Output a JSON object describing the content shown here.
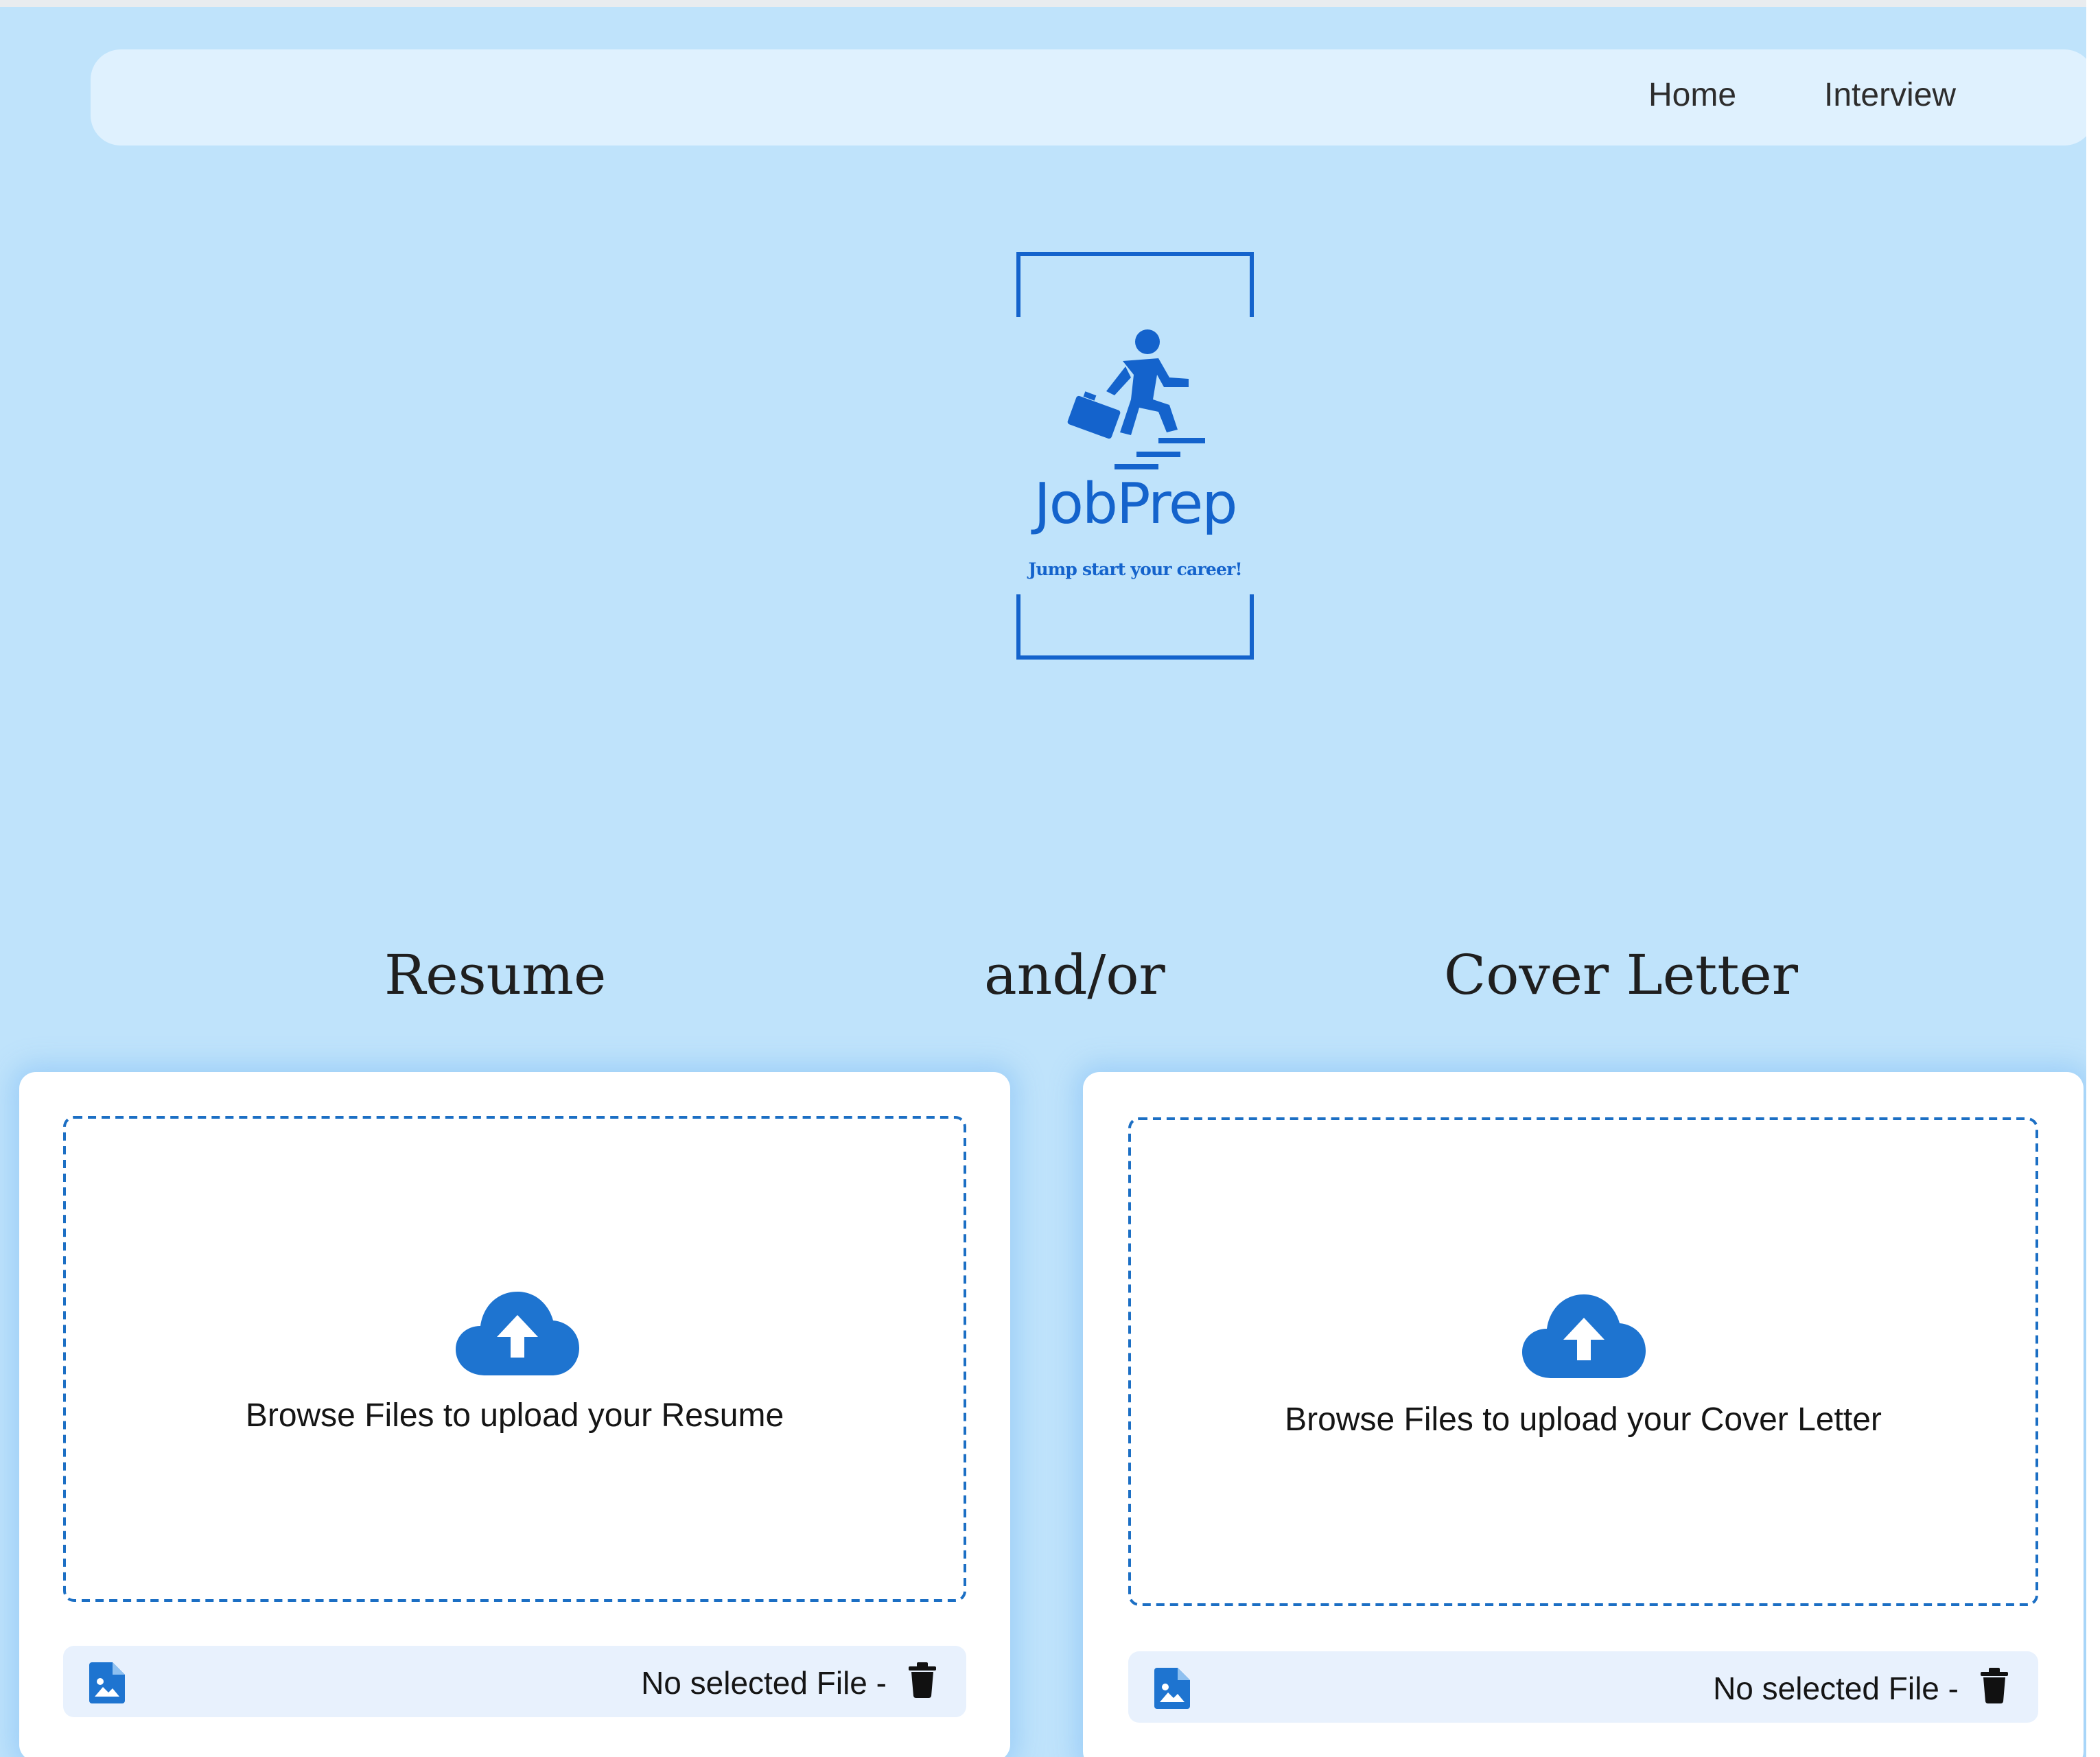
{
  "nav": {
    "home": "Home",
    "interview": "Interview"
  },
  "logo": {
    "title": "JobPrep",
    "tagline": "Jump start your career!",
    "icon": "person-climbing-stairs-with-briefcase-icon"
  },
  "headings": {
    "resume": "Resume",
    "andor": "and/or",
    "cover_letter": "Cover Letter"
  },
  "resume_card": {
    "upload_text": "Browse Files to upload your Resume",
    "file_status": "No selected File -",
    "upload_icon": "cloud-upload-icon",
    "file_icon": "image-file-icon",
    "delete_icon": "trash-icon"
  },
  "cover_card": {
    "upload_text": "Browse Files to upload your Cover Letter",
    "file_status": "No selected File -",
    "upload_icon": "cloud-upload-icon",
    "file_icon": "image-file-icon",
    "delete_icon": "trash-icon"
  },
  "colors": {
    "page_background": "#bfe3fb",
    "navbar_background": "#dff1fe",
    "brand_blue": "#1463cc",
    "dropzone_border": "#1c6fc4",
    "filebar_background": "#e8f1fd"
  }
}
